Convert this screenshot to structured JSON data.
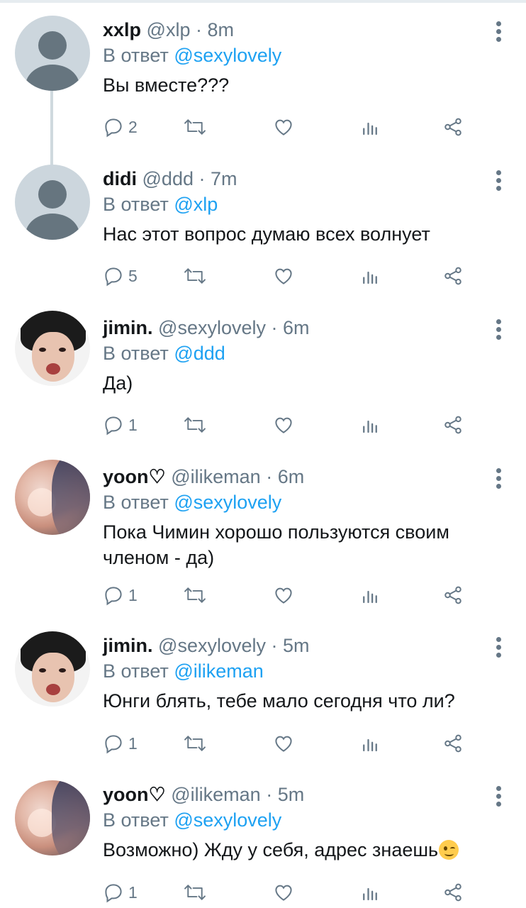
{
  "reply_prefix": "В ответ",
  "tweets": [
    {
      "name": "xxlp",
      "handle": "@xlp",
      "time": "8m",
      "reply_to": "@sexylovely",
      "lines": [
        "Вы вместе???"
      ],
      "replies": "2"
    },
    {
      "name": "didi",
      "handle": "@ddd",
      "time": "7m",
      "reply_to": "@xlp",
      "lines": [
        "Нас этот вопрос думаю всех волнует"
      ],
      "replies": "5"
    },
    {
      "name": "jimin.",
      "handle": "@sexylovely",
      "time": "6m",
      "reply_to": "@ddd",
      "lines": [
        "Да)"
      ],
      "replies": "1"
    },
    {
      "name": "yoon♡",
      "handle": "@ilikeman",
      "time": "6m",
      "reply_to": "@sexylovely",
      "lines": [
        "Пока Чимин хорошо пользуются своим",
        "членом - да)"
      ],
      "replies": "1"
    },
    {
      "name": "jimin.",
      "handle": "@sexylovely",
      "time": "5m",
      "reply_to": "@ilikeman",
      "lines": [
        "Юнги блять, тебе мало сегодня что ли?"
      ],
      "replies": "1"
    },
    {
      "name": "yoon♡",
      "handle": "@ilikeman",
      "time": "5m",
      "reply_to": "@sexylovely",
      "lines": [
        "Возможно) Жду у себя, адрес знаешь"
      ],
      "replies": "1",
      "emoji": "winking-face"
    }
  ],
  "colors": {
    "text": "#14171a",
    "secondary": "#657786",
    "mention": "#1da1f2",
    "thread_line": "#cfd9de"
  }
}
